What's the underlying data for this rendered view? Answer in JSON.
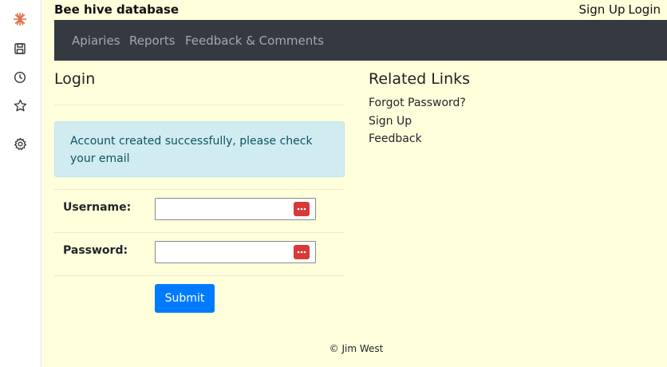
{
  "header": {
    "site_title": "Bee hive database",
    "sign_up": "Sign Up",
    "login": "Login"
  },
  "nav": {
    "items": [
      "Apiaries",
      "Reports",
      "Feedback & Comments"
    ]
  },
  "login": {
    "heading": "Login",
    "alert": "Account created successfully, please check your email",
    "username_label": "Username:",
    "username_value": "",
    "password_label": "Password:",
    "password_value": "",
    "submit_label": "Submit"
  },
  "related": {
    "heading": "Related Links",
    "links": [
      "Forgot Password?",
      "Sign Up",
      "Feedback"
    ]
  },
  "footer": {
    "text": "© Jim West"
  },
  "colors": {
    "page_bg": "#ffffdc",
    "navbar_bg": "#343a40",
    "alert_bg": "#d1ecf1",
    "alert_text": "#0c5460",
    "button": "#007bff",
    "password_manager_icon": "#d93838"
  },
  "sidebar_icons": [
    "app-logo-icon",
    "save-icon",
    "history-icon",
    "star-icon",
    "settings-icon"
  ]
}
